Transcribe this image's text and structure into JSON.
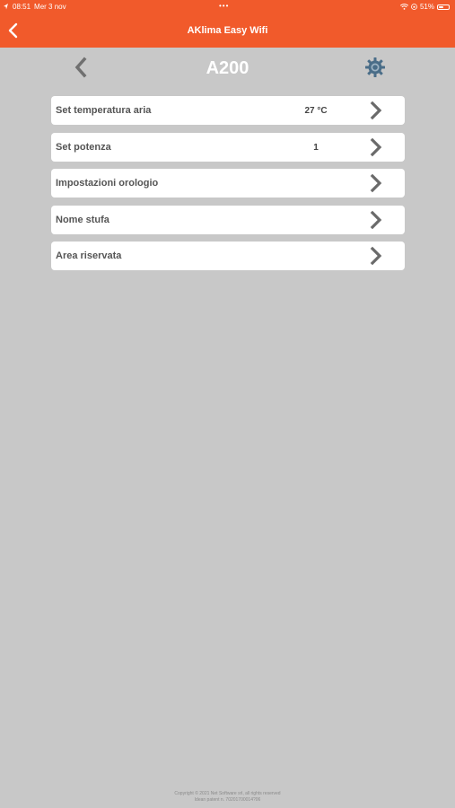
{
  "status_bar": {
    "time": "08:51",
    "date": "Mer 3 nov",
    "dots": "•••",
    "battery": "51%",
    "battery_level": 0.51
  },
  "nav": {
    "title": "AKlima Easy Wifi"
  },
  "device": {
    "name": "A200"
  },
  "menu": {
    "items": [
      {
        "label": "Set temperatura aria",
        "value": "27 °C"
      },
      {
        "label": "Set potenza",
        "value": "1"
      },
      {
        "label": "Impostazioni orologio",
        "value": ""
      },
      {
        "label": "Nome stufa",
        "value": ""
      },
      {
        "label": "Area riservata",
        "value": ""
      }
    ]
  },
  "footer": {
    "line1": "Copyright © 2021 Net Software srl, all rights reserved",
    "line2": "Idean patent n. 70201700014?06"
  },
  "colors": {
    "accent": "#f15a2b",
    "background": "#c8c8c8",
    "card": "#ffffff",
    "chevron": "#6a6a6a"
  }
}
